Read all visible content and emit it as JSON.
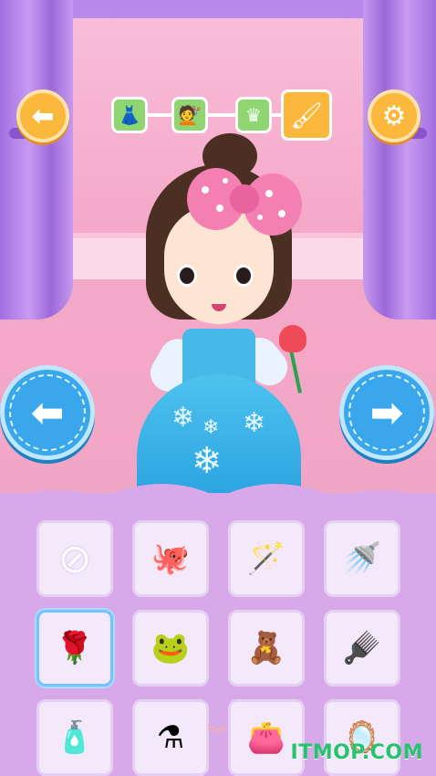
{
  "nav": {
    "back_icon": "arrow-left-icon",
    "settings_icon": "gear-icon",
    "prev_icon": "arrow-left-icon",
    "next_icon": "arrow-right-icon"
  },
  "categories": [
    {
      "icon": "dress-icon",
      "glyph": "👗",
      "active": false
    },
    {
      "icon": "hair-icon",
      "glyph": "💇",
      "active": false
    },
    {
      "icon": "crown-icon",
      "glyph": "♛",
      "active": false
    },
    {
      "icon": "makeup-brush-icon",
      "glyph": "🖌",
      "active": true
    }
  ],
  "items": [
    {
      "icon": "none-icon",
      "glyph": "⊘",
      "selected": false
    },
    {
      "icon": "octopus-icon",
      "glyph": "🐙",
      "selected": false
    },
    {
      "icon": "magic-wand-icon",
      "glyph": "🪄",
      "selected": false
    },
    {
      "icon": "watering-can-icon",
      "glyph": "🚿",
      "selected": false
    },
    {
      "icon": "rose-icon",
      "glyph": "🌹",
      "selected": true
    },
    {
      "icon": "frog-doll-icon",
      "glyph": "🐸",
      "selected": false
    },
    {
      "icon": "teddy-bear-icon",
      "glyph": "🧸",
      "selected": false
    },
    {
      "icon": "comb-icon",
      "glyph": "🪮",
      "selected": false
    },
    {
      "icon": "perfume-icon",
      "glyph": "🧴",
      "selected": false
    },
    {
      "icon": "potion-bottle-icon",
      "glyph": "⚗",
      "selected": false
    },
    {
      "icon": "purse-icon",
      "glyph": "👛",
      "selected": false
    },
    {
      "icon": "hand-mirror-icon",
      "glyph": "🪞",
      "selected": false
    }
  ],
  "watermark": "ITMOP.COM",
  "colors": {
    "accent": "#fbb83d",
    "nav_blue": "#3aa7ec",
    "panel": "#d7a9e8",
    "category_green": "#8fd672"
  }
}
